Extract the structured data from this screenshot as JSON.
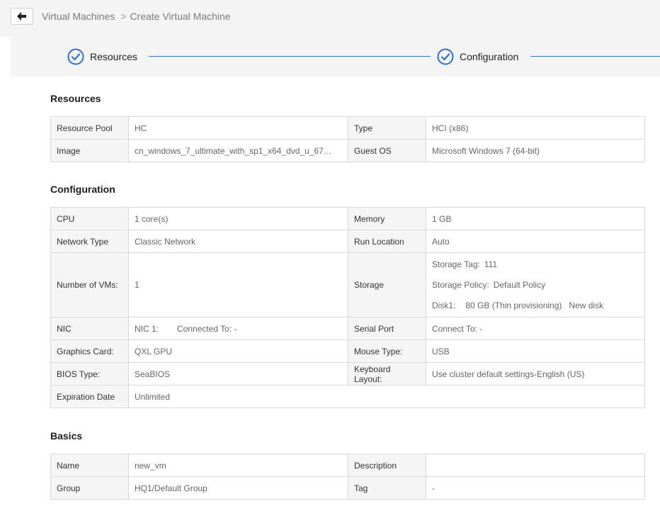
{
  "breadcrumb": {
    "parent": "Virtual Machines",
    "separator": ">",
    "current": "Create Virtual Machine"
  },
  "steps": [
    {
      "label": "Resources",
      "status": "done"
    },
    {
      "label": "Configuration",
      "status": "done"
    }
  ],
  "colors": {
    "accent": "#2f6fd0"
  },
  "resources": {
    "title": "Resources",
    "rows": [
      {
        "k1": "Resource Pool",
        "v1": "HC",
        "k2": "Type",
        "v2": "HCI (x86)"
      },
      {
        "k1": "Image",
        "v1": "cn_windows_7_ultimate_with_sp1_x64_dvd_u_67…",
        "k2": "Guest OS",
        "v2": "Microsoft Windows 7 (64-bit)"
      }
    ]
  },
  "configuration": {
    "title": "Configuration",
    "cpu": {
      "k1": "CPU",
      "v1": "1 core(s)",
      "k2": "Memory",
      "v2": "1 GB"
    },
    "network": {
      "k1": "Network Type",
      "v1": "Classic Network",
      "k2": "Run Location",
      "v2": "Auto"
    },
    "vms": {
      "k1": "Number of VMs:",
      "v1": "1",
      "k2": "Storage",
      "storage_tag_label": "Storage Tag:",
      "storage_tag": "111",
      "storage_policy_label": "Storage Policy:",
      "storage_policy": "Default Policy",
      "disk_label": "Disk1:",
      "disk_value": "80 GB (Thin provisioning)",
      "disk_type": "New disk"
    },
    "nic": {
      "k1": "NIC",
      "nic_label": "NIC 1:",
      "connected_label": "Connected To:",
      "connected_value": "-",
      "k2": "Serial Port",
      "v2": "Connect To: -"
    },
    "graphics": {
      "k1": "Graphics Card:",
      "v1": "QXL GPU",
      "k2": "Mouse Type:",
      "v2": "USB"
    },
    "bios": {
      "k1": "BIOS Type:",
      "v1": "SeaBIOS",
      "k2": "Keyboard Layout:",
      "v2": "Use cluster default settings-English (US)"
    },
    "expiration": {
      "k1": "Expiration Date",
      "v1": "Unlimited"
    }
  },
  "basics": {
    "title": "Basics",
    "rows": [
      {
        "k1": "Name",
        "v1": "new_vm",
        "k2": "Description",
        "v2": ""
      },
      {
        "k1": "Group",
        "v1": "HQ1/Default Group",
        "k2": "Tag",
        "v2": "-"
      }
    ]
  }
}
